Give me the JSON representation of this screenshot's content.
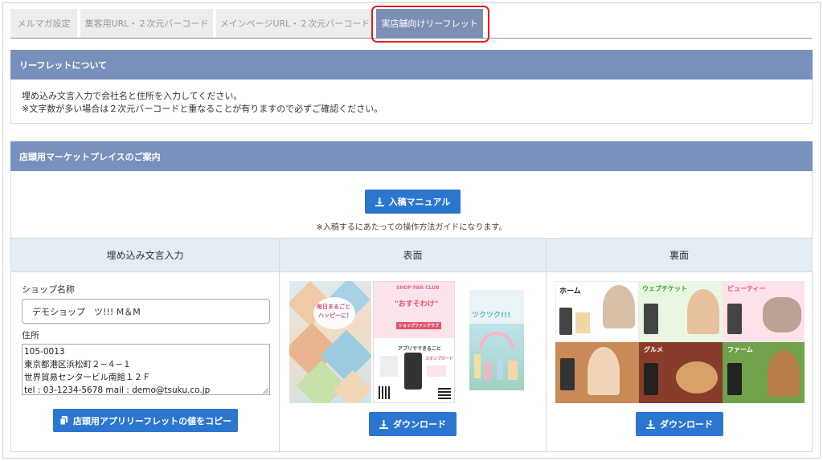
{
  "tabs": [
    {
      "label": "メルマガ設定"
    },
    {
      "label": "集客用URL・２次元バーコード"
    },
    {
      "label": "メインページURL・２次元バーコード"
    },
    {
      "label": "実店舗向けリーフレット"
    }
  ],
  "about": {
    "title": "リーフレットについて",
    "line1": "埋め込み文言入力で会社名と住所を入力してください。",
    "line2": "※文字数が多い場合は２次元バーコードと重なることが有りますので必ずご確認ください。"
  },
  "market": {
    "title": "店頭用マーケットプレイスのご案内",
    "manual_button": "入稿マニュアル",
    "manual_note": "※入稿するにあたっての操作方法ガイドになります。"
  },
  "columns": {
    "embed": {
      "header": "埋め込み文言入力",
      "shop_label": "ショップ名称",
      "shop_value": "デモショップ　ツ!!! M＆M",
      "address_label": "住所",
      "address_lines": {
        "l1": "105-0013",
        "l2": "東京都港区浜松町２−４−１",
        "l3": "世界貿易センタービル南館１２Ｆ",
        "l4": "tel : 03-1234-5678 mail : demo@tsuku.co.jp"
      },
      "copy_button": "店頭用アプリリーフレットの値をコピー"
    },
    "front": {
      "header": "表面",
      "download_button": "ダウンロード",
      "preview": {
        "t1": "毎日まるごと",
        "t2": "ハッピーに！",
        "t3": "SHOP FAN CLUB",
        "t4": "\"おすそわけ\"",
        "t5": "ショップファンクラブ",
        "t6": "アプリでできること",
        "t7": "スタンプカード",
        "t8": "ツクツク!!!"
      }
    },
    "back": {
      "header": "裏面",
      "download_button": "ダウンロード",
      "preview": {
        "home": "ホーム",
        "ticket": "ウェブチケット",
        "beauty": "ビューティー",
        "gourmet": "グルメ",
        "farm": "ファーム"
      }
    }
  },
  "colors": {
    "accent": "#2b77d0",
    "panel_header": "#7890bb",
    "active_tab": "#7d8fb5",
    "highlight": "#e0201c"
  }
}
